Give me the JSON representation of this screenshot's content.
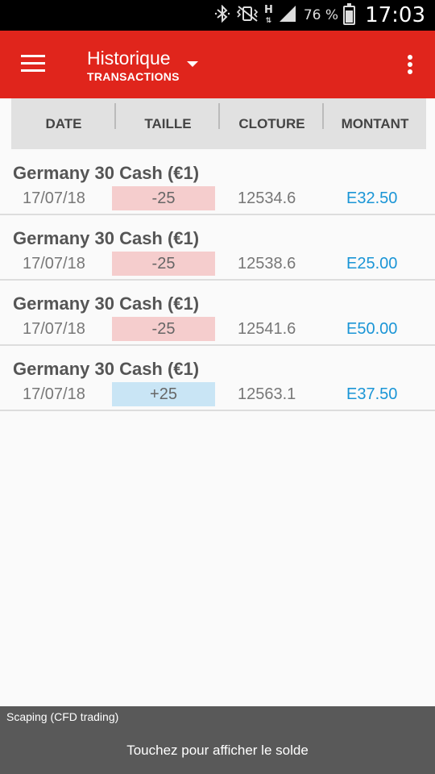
{
  "status_bar": {
    "icons": [
      "bluetooth-icon",
      "vibrate-off-icon",
      "network-h-icon",
      "signal-icon",
      "battery-icon"
    ],
    "network_label": "H",
    "battery_percent": "76 %",
    "battery_level": 0.76,
    "time": "17:03"
  },
  "app_bar": {
    "title": "Historique",
    "subtitle": "TRANSACTIONS",
    "background_color": "#e0251c"
  },
  "table": {
    "headers": [
      "DATE",
      "TAILLE",
      "CLOTURE",
      "MONTANT"
    ],
    "rows": [
      {
        "name": "Germany 30 Cash (€1)",
        "date": "17/07/18",
        "size": "-25",
        "close": "12534.6",
        "amount": "E32.50"
      },
      {
        "name": "Germany 30 Cash (€1)",
        "date": "17/07/18",
        "size": "-25",
        "close": "12538.6",
        "amount": "E25.00"
      },
      {
        "name": "Germany 30 Cash (€1)",
        "date": "17/07/18",
        "size": "-25",
        "close": "12541.6",
        "amount": "E50.00"
      },
      {
        "name": "Germany 30 Cash (€1)",
        "date": "17/07/18",
        "size": "+25",
        "close": "12563.1",
        "amount": "E37.50"
      }
    ],
    "negative_color": "#f5cdcd",
    "positive_color": "#c9e5f5",
    "amount_color": "#1a95d6"
  },
  "bottom_bar": {
    "account": "Scaping (CFD trading)",
    "hint": "Touchez pour afficher le solde"
  }
}
